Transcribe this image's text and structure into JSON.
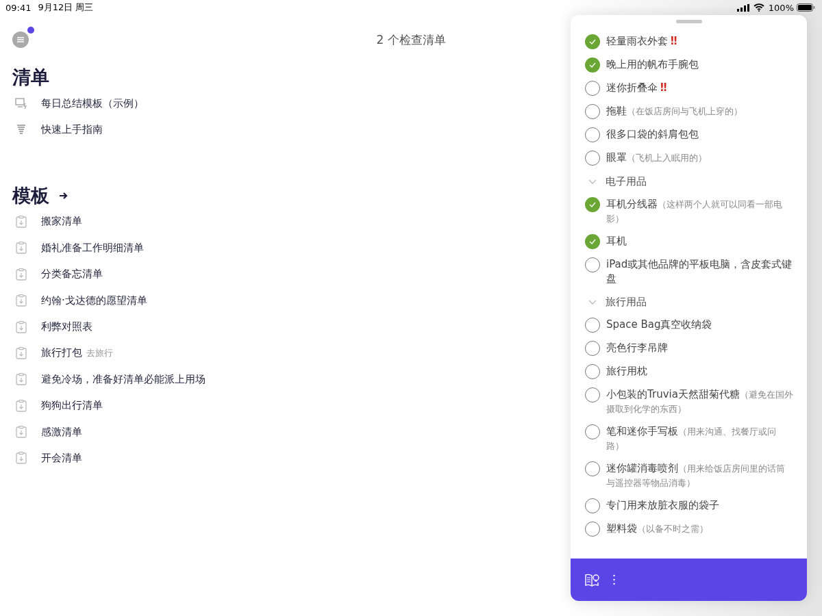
{
  "status_bar": {
    "time": "09:41",
    "date": "9月12日 周三",
    "battery": "100%"
  },
  "header": {
    "title": "2 个检查清单",
    "menu_badge": true
  },
  "checklists": {
    "title": "清单",
    "items": [
      {
        "kind": "summary",
        "label": "每日总结模板（示例）"
      },
      {
        "kind": "guide",
        "label": "快速上手指南"
      }
    ]
  },
  "templates": {
    "title": "模板",
    "items": [
      {
        "label": "搬家清单"
      },
      {
        "label": "婚礼准备工作明细清单"
      },
      {
        "label": "分类备忘清单"
      },
      {
        "label": "约翰·戈达德的愿望清单"
      },
      {
        "label": "利弊对照表"
      },
      {
        "label": "旅行打包",
        "tag": "去旅行"
      },
      {
        "label": "避免冷场，准备好清单必能派上用场"
      },
      {
        "label": "狗狗出行清单"
      },
      {
        "label": "感激清单"
      },
      {
        "label": "开会清单"
      }
    ]
  },
  "sheet": {
    "rows": [
      {
        "kind": "item",
        "text": "轻量雨衣外套",
        "flag": "‼",
        "checked": true
      },
      {
        "kind": "item",
        "text": "晚上用的帆布手腕包",
        "checked": true
      },
      {
        "kind": "item",
        "text": "迷你折叠伞",
        "flag": "‼",
        "checked": false
      },
      {
        "kind": "item",
        "text": "拖鞋",
        "note": "（在饭店房间与飞机上穿的）",
        "checked": false
      },
      {
        "kind": "item",
        "text": "很多口袋的斜肩包包",
        "checked": false
      },
      {
        "kind": "item",
        "text": "眼罩",
        "note": "（飞机上入眠用的）",
        "checked": false
      },
      {
        "kind": "section",
        "text": "电子用品",
        "expanded": true
      },
      {
        "kind": "item",
        "text": "耳机分线器",
        "note": "（这样两个人就可以同看一部电影）",
        "checked": true
      },
      {
        "kind": "item",
        "text": "耳机",
        "checked": true
      },
      {
        "kind": "item",
        "text": "iPad或其他品牌的平板电脑，含皮套式键盘",
        "checked": false
      },
      {
        "kind": "section",
        "text": "旅行用品",
        "expanded": true
      },
      {
        "kind": "item",
        "text": "Space Bag真空收纳袋",
        "checked": false
      },
      {
        "kind": "item",
        "text": "亮色行李吊牌",
        "checked": false
      },
      {
        "kind": "item",
        "text": "旅行用枕",
        "checked": false
      },
      {
        "kind": "item",
        "text": "小包装的Truvia天然甜菊代糖",
        "note": "（避免在国外摄取到化学的东西）",
        "checked": false
      },
      {
        "kind": "item",
        "text": "笔和迷你手写板",
        "note": "（用来沟通、找餐厅或问路）",
        "checked": false
      },
      {
        "kind": "item",
        "text": "迷你罐消毒喷剂",
        "note": "（用来给饭店房间里的话筒与遥控器等物品消毒）",
        "checked": false
      },
      {
        "kind": "item",
        "text": "专门用来放脏衣服的袋子",
        "checked": false
      },
      {
        "kind": "item",
        "text": "塑料袋",
        "note": "（以备不时之需）",
        "checked": false
      }
    ]
  }
}
